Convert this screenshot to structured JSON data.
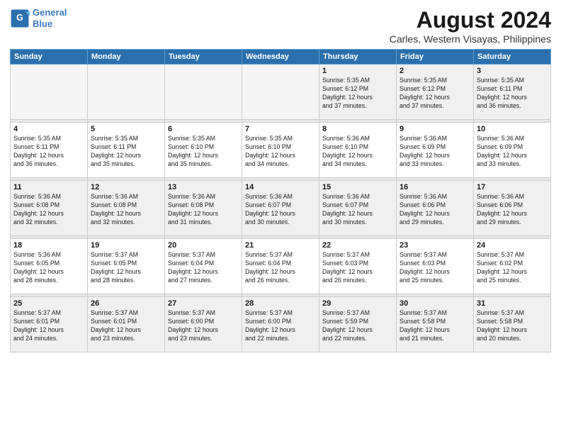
{
  "header": {
    "logo_line1": "General",
    "logo_line2": "Blue",
    "month_year": "August 2024",
    "location": "Carles, Western Visayas, Philippines"
  },
  "weekdays": [
    "Sunday",
    "Monday",
    "Tuesday",
    "Wednesday",
    "Thursday",
    "Friday",
    "Saturday"
  ],
  "weeks": [
    [
      {
        "day": "",
        "info": ""
      },
      {
        "day": "",
        "info": ""
      },
      {
        "day": "",
        "info": ""
      },
      {
        "day": "",
        "info": ""
      },
      {
        "day": "1",
        "info": "Sunrise: 5:35 AM\nSunset: 6:12 PM\nDaylight: 12 hours\nand 37 minutes."
      },
      {
        "day": "2",
        "info": "Sunrise: 5:35 AM\nSunset: 6:12 PM\nDaylight: 12 hours\nand 37 minutes."
      },
      {
        "day": "3",
        "info": "Sunrise: 5:35 AM\nSunset: 6:11 PM\nDaylight: 12 hours\nand 36 minutes."
      }
    ],
    [
      {
        "day": "4",
        "info": "Sunrise: 5:35 AM\nSunset: 6:11 PM\nDaylight: 12 hours\nand 36 minutes."
      },
      {
        "day": "5",
        "info": "Sunrise: 5:35 AM\nSunset: 6:11 PM\nDaylight: 12 hours\nand 35 minutes."
      },
      {
        "day": "6",
        "info": "Sunrise: 5:35 AM\nSunset: 6:10 PM\nDaylight: 12 hours\nand 35 minutes."
      },
      {
        "day": "7",
        "info": "Sunrise: 5:35 AM\nSunset: 6:10 PM\nDaylight: 12 hours\nand 34 minutes."
      },
      {
        "day": "8",
        "info": "Sunrise: 5:36 AM\nSunset: 6:10 PM\nDaylight: 12 hours\nand 34 minutes."
      },
      {
        "day": "9",
        "info": "Sunrise: 5:36 AM\nSunset: 6:09 PM\nDaylight: 12 hours\nand 33 minutes."
      },
      {
        "day": "10",
        "info": "Sunrise: 5:36 AM\nSunset: 6:09 PM\nDaylight: 12 hours\nand 33 minutes."
      }
    ],
    [
      {
        "day": "11",
        "info": "Sunrise: 5:36 AM\nSunset: 6:08 PM\nDaylight: 12 hours\nand 32 minutes."
      },
      {
        "day": "12",
        "info": "Sunrise: 5:36 AM\nSunset: 6:08 PM\nDaylight: 12 hours\nand 32 minutes."
      },
      {
        "day": "13",
        "info": "Sunrise: 5:36 AM\nSunset: 6:08 PM\nDaylight: 12 hours\nand 31 minutes."
      },
      {
        "day": "14",
        "info": "Sunrise: 5:36 AM\nSunset: 6:07 PM\nDaylight: 12 hours\nand 30 minutes."
      },
      {
        "day": "15",
        "info": "Sunrise: 5:36 AM\nSunset: 6:07 PM\nDaylight: 12 hours\nand 30 minutes."
      },
      {
        "day": "16",
        "info": "Sunrise: 5:36 AM\nSunset: 6:06 PM\nDaylight: 12 hours\nand 29 minutes."
      },
      {
        "day": "17",
        "info": "Sunrise: 5:36 AM\nSunset: 6:06 PM\nDaylight: 12 hours\nand 29 minutes."
      }
    ],
    [
      {
        "day": "18",
        "info": "Sunrise: 5:36 AM\nSunset: 6:05 PM\nDaylight: 12 hours\nand 28 minutes."
      },
      {
        "day": "19",
        "info": "Sunrise: 5:37 AM\nSunset: 6:05 PM\nDaylight: 12 hours\nand 28 minutes."
      },
      {
        "day": "20",
        "info": "Sunrise: 5:37 AM\nSunset: 6:04 PM\nDaylight: 12 hours\nand 27 minutes."
      },
      {
        "day": "21",
        "info": "Sunrise: 5:37 AM\nSunset: 6:04 PM\nDaylight: 12 hours\nand 26 minutes."
      },
      {
        "day": "22",
        "info": "Sunrise: 5:37 AM\nSunset: 6:03 PM\nDaylight: 12 hours\nand 26 minutes."
      },
      {
        "day": "23",
        "info": "Sunrise: 5:37 AM\nSunset: 6:03 PM\nDaylight: 12 hours\nand 25 minutes."
      },
      {
        "day": "24",
        "info": "Sunrise: 5:37 AM\nSunset: 6:02 PM\nDaylight: 12 hours\nand 25 minutes."
      }
    ],
    [
      {
        "day": "25",
        "info": "Sunrise: 5:37 AM\nSunset: 6:01 PM\nDaylight: 12 hours\nand 24 minutes."
      },
      {
        "day": "26",
        "info": "Sunrise: 5:37 AM\nSunset: 6:01 PM\nDaylight: 12 hours\nand 23 minutes."
      },
      {
        "day": "27",
        "info": "Sunrise: 5:37 AM\nSunset: 6:00 PM\nDaylight: 12 hours\nand 23 minutes."
      },
      {
        "day": "28",
        "info": "Sunrise: 5:37 AM\nSunset: 6:00 PM\nDaylight: 12 hours\nand 22 minutes."
      },
      {
        "day": "29",
        "info": "Sunrise: 5:37 AM\nSunset: 5:59 PM\nDaylight: 12 hours\nand 22 minutes."
      },
      {
        "day": "30",
        "info": "Sunrise: 5:37 AM\nSunset: 5:58 PM\nDaylight: 12 hours\nand 21 minutes."
      },
      {
        "day": "31",
        "info": "Sunrise: 5:37 AM\nSunset: 5:58 PM\nDaylight: 12 hours\nand 20 minutes."
      }
    ]
  ]
}
